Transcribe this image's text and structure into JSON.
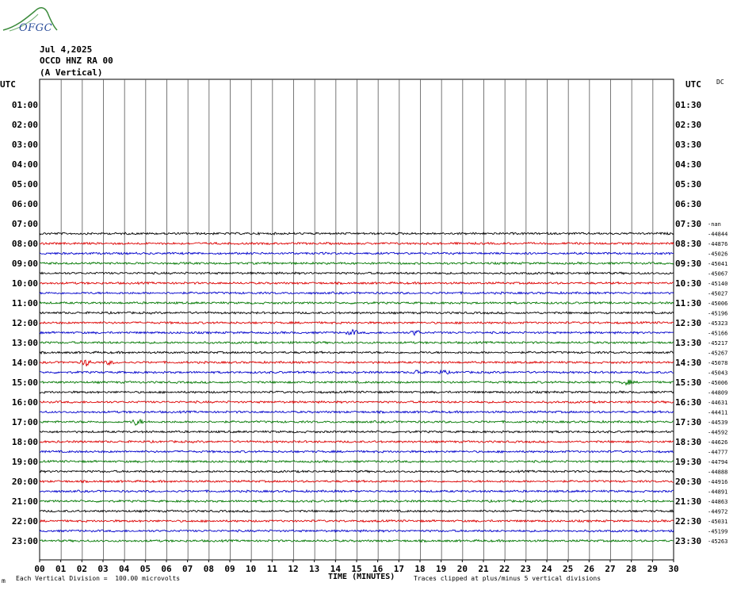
{
  "logo": {
    "text": "OFGC"
  },
  "header": {
    "date": "Jul 4,2025",
    "station": "OCCD HNZ RA 00",
    "component": "(A Vertical)"
  },
  "axes": {
    "left_title": "UTC",
    "right_title": "UTC",
    "dc_label": "DC",
    "x_title": "TIME (MINUTES)",
    "scale_note": "Each Vertical Division =  100.00 microvolts",
    "clip_note": "Traces clipped at plus/minus 5 vertical divisions",
    "corner_mark": "m"
  },
  "colors": {
    "trace_cycle": [
      "#000000",
      "#dd0000",
      "#0000cc",
      "#007700"
    ],
    "grid": "#000000"
  },
  "chart_data": {
    "type": "line",
    "subtype": "helicorder",
    "title": "",
    "xlabel": "TIME (MINUTES)",
    "ylabel": "UTC",
    "xlim": [
      0,
      30
    ],
    "x_ticks": [
      "00",
      "01",
      "02",
      "03",
      "04",
      "05",
      "06",
      "07",
      "08",
      "09",
      "10",
      "11",
      "12",
      "13",
      "14",
      "15",
      "16",
      "17",
      "18",
      "19",
      "20",
      "21",
      "22",
      "23",
      "24",
      "25",
      "26",
      "27",
      "28",
      "29",
      "30"
    ],
    "left_labels": [
      "01:00",
      "02:00",
      "03:00",
      "04:00",
      "05:00",
      "06:00",
      "07:00",
      "08:00",
      "09:00",
      "10:00",
      "11:00",
      "12:00",
      "13:00",
      "14:00",
      "15:00",
      "16:00",
      "17:00",
      "18:00",
      "19:00",
      "20:00",
      "21:00",
      "22:00",
      "23:00"
    ],
    "right_labels": [
      "01:30",
      "02:30",
      "03:30",
      "04:30",
      "05:30",
      "06:30",
      "07:30",
      "08:30",
      "09:30",
      "10:30",
      "11:30",
      "12:30",
      "13:30",
      "14:30",
      "15:30",
      "16:30",
      "17:30",
      "18:30",
      "19:30",
      "20:30",
      "21:30",
      "22:30",
      "23:30"
    ],
    "first_trace_row": 15,
    "dc_values": [
      "-nan",
      "-44844",
      "-44876",
      "-45026",
      "-45041",
      "-45067",
      "-45140",
      "-45027",
      "-45006",
      "-45196",
      "-45323",
      "-45166",
      "-45217",
      "-45267",
      "-45078",
      "-45043",
      "-45006",
      "-44809",
      "-44631",
      "-44411",
      "-44539",
      "-44592",
      "-44626",
      "-44777",
      "-44794",
      "-44888",
      "-44916",
      "-44891",
      "-44863",
      "-44972",
      "-45031",
      "-45199",
      "-45263"
    ],
    "events": [
      {
        "row": 28,
        "minute": 2.2,
        "amplitude": 4
      },
      {
        "row": 28,
        "minute": 3.3,
        "amplitude": 2
      },
      {
        "row": 34,
        "minute": 4.6,
        "amplitude": 4
      },
      {
        "row": 25,
        "minute": 14.8,
        "amplitude": 3
      },
      {
        "row": 25,
        "minute": 17.8,
        "amplitude": 3
      },
      {
        "row": 29,
        "minute": 17.9,
        "amplitude": 3
      },
      {
        "row": 29,
        "minute": 19.1,
        "amplitude": 2
      },
      {
        "row": 30,
        "minute": 27.8,
        "amplitude": 3
      }
    ]
  }
}
